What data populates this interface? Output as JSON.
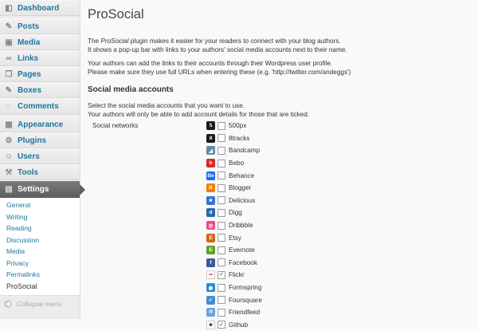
{
  "sidebar": {
    "items": [
      {
        "label": "Dashboard",
        "icon": "dashboard-icon",
        "glyph": "◧"
      },
      {
        "label": "Posts",
        "icon": "pin-icon",
        "glyph": "✎"
      },
      {
        "label": "Media",
        "icon": "media-icon",
        "glyph": "▣"
      },
      {
        "label": "Links",
        "icon": "link-icon",
        "glyph": "∞"
      },
      {
        "label": "Pages",
        "icon": "pages-icon",
        "glyph": "❐"
      },
      {
        "label": "Boxes",
        "icon": "pin-icon",
        "glyph": "✎"
      },
      {
        "label": "Comments",
        "icon": "comment-icon",
        "glyph": "◌"
      },
      {
        "label": "Appearance",
        "icon": "appearance-icon",
        "glyph": "▦"
      },
      {
        "label": "Plugins",
        "icon": "plugin-icon",
        "glyph": "⚙"
      },
      {
        "label": "Users",
        "icon": "users-icon",
        "glyph": "☺"
      },
      {
        "label": "Tools",
        "icon": "tools-icon",
        "glyph": "⚒"
      },
      {
        "label": "Settings",
        "icon": "settings-icon",
        "glyph": "▤"
      }
    ],
    "submenu": [
      "General",
      "Writing",
      "Reading",
      "Discussion",
      "Media",
      "Privacy",
      "Permalinks",
      "ProSocial"
    ],
    "collapse_label": "Collapse menu"
  },
  "main": {
    "title": "ProSocial",
    "intro1_prefix": "The ",
    "intro1_em": "ProSocial",
    "intro1_suffix": " plugin makes it easier for your readers to connect with your blog authors.",
    "intro1_line2": "It shows a pop-up bar with links to your authors' social media accounts next to their name.",
    "intro2_line1": "Your authors can add the links to their accounts through their Wordpress user profile.",
    "intro2_line2": "Please make sure they use full URLs when entering these (e.g. 'http://twitter.com/andeggs')",
    "section_title": "Social media accounts",
    "intro3_line1": "Select the social media accounts that you want to use.",
    "intro3_line2": "Your authors will only be able to add account details for those that are ticked.",
    "form_label": "Social networks",
    "networks": [
      {
        "name": "500px",
        "checked": false,
        "color": "#1a1a1a",
        "glyph": "5"
      },
      {
        "name": "8tracks",
        "checked": false,
        "color": "#1a1a1a",
        "glyph": "8"
      },
      {
        "name": "Bandcamp",
        "checked": false,
        "color": "#5f8ea3",
        "glyph": "◢"
      },
      {
        "name": "Bebo",
        "checked": false,
        "color": "#d42a2a",
        "glyph": "b"
      },
      {
        "name": "Behance",
        "checked": false,
        "color": "#1769ff",
        "glyph": "Be"
      },
      {
        "name": "Blogger",
        "checked": false,
        "color": "#f57d00",
        "glyph": "B"
      },
      {
        "name": "Delicious",
        "checked": false,
        "color": "#3274d1",
        "glyph": "■"
      },
      {
        "name": "Digg",
        "checked": false,
        "color": "#2b67a8",
        "glyph": "d"
      },
      {
        "name": "Dribbble",
        "checked": false,
        "color": "#ea4c89",
        "glyph": "◎"
      },
      {
        "name": "Etsy",
        "checked": false,
        "color": "#d5641c",
        "glyph": "E"
      },
      {
        "name": "Evernote",
        "checked": false,
        "color": "#5ba525",
        "glyph": "E"
      },
      {
        "name": "Facebook",
        "checked": false,
        "color": "#3b5998",
        "glyph": "f"
      },
      {
        "name": "Flickr",
        "checked": true,
        "color": "#ffffff",
        "glyph": "••"
      },
      {
        "name": "Formspring",
        "checked": false,
        "color": "#2a89d8",
        "glyph": "◉"
      },
      {
        "name": "Foursquare",
        "checked": false,
        "color": "#3b8fd6",
        "glyph": "✓"
      },
      {
        "name": "Friendfeed",
        "checked": false,
        "color": "#6fa0dc",
        "glyph": "ff"
      },
      {
        "name": "Github",
        "checked": true,
        "color": "#ffffff",
        "glyph": "☻"
      }
    ]
  }
}
